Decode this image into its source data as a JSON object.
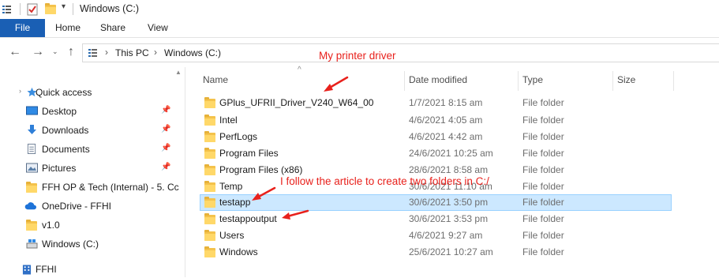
{
  "window": {
    "title": "Windows (C:)"
  },
  "ribbon": {
    "tabs": [
      "File",
      "Home",
      "Share",
      "View"
    ]
  },
  "address": {
    "crumbs": [
      "This PC",
      "Windows (C:)"
    ]
  },
  "nav": {
    "items": [
      {
        "label": "Quick access",
        "icon": "star-icon",
        "pinned": false
      },
      {
        "label": "Desktop",
        "icon": "desktop-icon",
        "pinned": true
      },
      {
        "label": "Downloads",
        "icon": "download-icon",
        "pinned": true
      },
      {
        "label": "Documents",
        "icon": "documents-icon",
        "pinned": true
      },
      {
        "label": "Pictures",
        "icon": "pictures-icon",
        "pinned": true
      },
      {
        "label": "FFH OP & Tech (Internal) - 5. Cc",
        "icon": "folder-icon",
        "pinned": false
      },
      {
        "label": "OneDrive - FFHI",
        "icon": "cloud-icon",
        "pinned": false
      },
      {
        "label": "v1.0",
        "icon": "folder-icon",
        "pinned": false
      },
      {
        "label": "Windows (C:)",
        "icon": "drive-icon",
        "pinned": false
      },
      {
        "label": "FFHI",
        "icon": "building-icon",
        "pinned": false
      }
    ]
  },
  "columns": {
    "name": "Name",
    "date": "Date modified",
    "type": "Type",
    "size": "Size"
  },
  "files": [
    {
      "name": "GPlus_UFRII_Driver_V240_W64_00",
      "date": "1/7/2021 8:15 am",
      "type": "File folder"
    },
    {
      "name": "Intel",
      "date": "4/6/2021 4:05 am",
      "type": "File folder"
    },
    {
      "name": "PerfLogs",
      "date": "4/6/2021 4:42 am",
      "type": "File folder"
    },
    {
      "name": "Program Files",
      "date": "24/6/2021 10:25 am",
      "type": "File folder"
    },
    {
      "name": "Program Files (x86)",
      "date": "28/6/2021 8:58 am",
      "type": "File folder"
    },
    {
      "name": "Temp",
      "date": "30/6/2021 11:10 am",
      "type": "File folder"
    },
    {
      "name": "testapp",
      "date": "30/6/2021 3:50 pm",
      "type": "File folder",
      "selected": true
    },
    {
      "name": "testappoutput",
      "date": "30/6/2021 3:53 pm",
      "type": "File folder"
    },
    {
      "name": "Users",
      "date": "4/6/2021 9:27 am",
      "type": "File folder"
    },
    {
      "name": "Windows",
      "date": "25/6/2021 10:27 am",
      "type": "File folder"
    }
  ],
  "annotations": {
    "driver_note": "My printer driver",
    "folders_note": "I follow the article to create two folders in C:/"
  },
  "colors": {
    "accent": "#1a5fb4",
    "selection": "#cce8ff",
    "annotation": "#e8211c"
  }
}
